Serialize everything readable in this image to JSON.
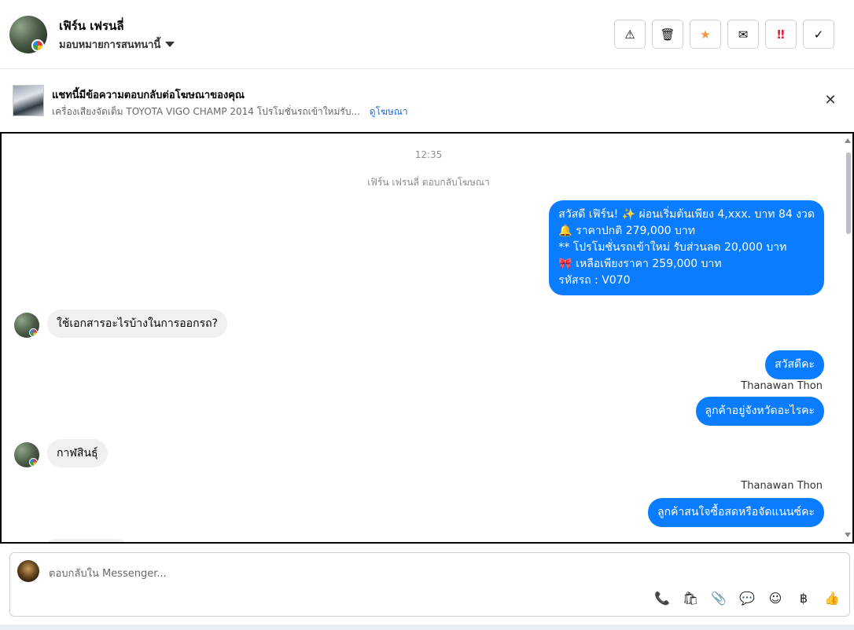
{
  "header": {
    "name": "เฟิร์น เฟรนลี่",
    "assign_label": "มอบหมายการสนทนานี้",
    "tools": [
      {
        "icon": "warning-icon",
        "glyph": "⚠",
        "color": "#1c1e21"
      },
      {
        "icon": "trash-icon",
        "glyph": "🗑",
        "color": "#1c1e21"
      },
      {
        "icon": "star-icon",
        "glyph": "★",
        "color": "#f7923a"
      },
      {
        "icon": "mail-open-icon",
        "glyph": "✉",
        "color": "#1c1e21"
      },
      {
        "icon": "important-icon",
        "glyph": "‼",
        "color": "#e41e3f"
      },
      {
        "icon": "check-icon",
        "glyph": "✓",
        "color": "#1c1e21"
      }
    ]
  },
  "notice": {
    "title": "แชทนี้มีข้อความตอบกลับต่อโฆษณาของคุณ",
    "subtitle": "เครื่องเสียงจัดเต็ม TOYOTA VIGO CHAMP 2014 โปรโมชั่นรถเข้าใหม่รับ...",
    "link": "ดูโฆษณา",
    "close_glyph": "✕"
  },
  "chat": {
    "time": "12:35",
    "system_note": "เฟิร์น เฟรนลี่ ตอบกลับโฆษณา",
    "ad_message_lines": [
      "สวัสดี เฟิร์น! ✨  ผ่อนเริ่มต้นเพียง 4,xxx. บาท 84 งวด",
      "🔔 ราคาปกติ 279,000 บาท",
      "** โปรโมชั่นรถเข้าใหม่ รับส่วนลด 20,000 บาท",
      "🎀  เหลือเพียงราคา 259,000 บาท",
      " รหัสรถ : V070"
    ],
    "in_msg_1": "ใช้เอกสารอะไรบ้างในการออกรถ?",
    "out_msg_1": "สวัสดีคะ",
    "sender_1": "Thanawan Thon",
    "out_msg_2": "ลูกค้าอยู่จังหวัดอะไรคะ",
    "in_msg_2": "กาฬสินธุ์",
    "sender_2": "Thanawan Thon",
    "out_msg_3": "ลูกค้าสนใจซื้อสดหรือจัดแนนซ์คะ"
  },
  "composer": {
    "placeholder": "ตอบกลับใน Messenger...",
    "icons": [
      {
        "name": "call-add-icon",
        "glyph": "📞"
      },
      {
        "name": "shopping-bag-icon",
        "glyph": "🛍"
      },
      {
        "name": "attachment-icon",
        "glyph": "📎"
      },
      {
        "name": "chat-bubble-icon",
        "glyph": "💬"
      },
      {
        "name": "emoji-icon",
        "glyph": "☺"
      },
      {
        "name": "baht-icon",
        "glyph": "฿"
      },
      {
        "name": "thumbs-up-icon",
        "glyph": "👍"
      }
    ]
  }
}
